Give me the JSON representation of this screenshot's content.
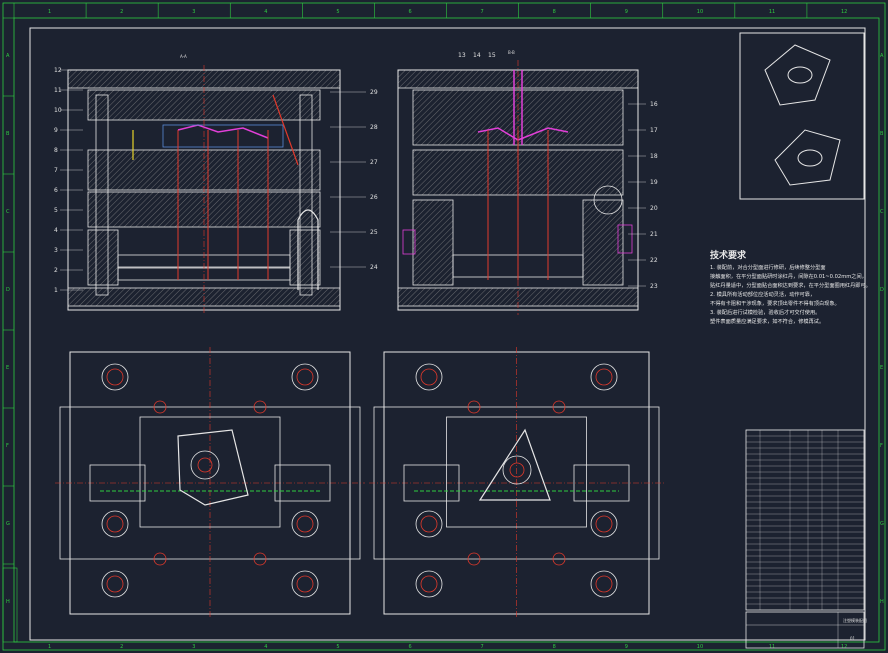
{
  "notes": {
    "title": "技术要求",
    "lines": [
      "1. 装配前，对合分型面进行修研，后续修整分型面",
      "接触面积，在平分型面贴研时涂红丹，间隙在0.01~0.02mm之间，",
      "贴红丹量适中，分型面贴合面积达到要求，在平分型面圈用红丹即可。",
      "2. 模具所有活动部位应活动灵活，动作可靠，",
      "不得有卡阻和干涉现象，要求顶出零件不得有顶白现象。",
      "3. 装配后进行试模检验，验收后才可交付使用。",
      "塑件表面质量应满足要求，如不符合，修模再试。"
    ]
  },
  "drawing": {
    "section_label_left": "A-A",
    "section_label_right": "B-B",
    "left_part_numbers": [
      "12",
      "11",
      "10",
      "9",
      "8",
      "7",
      "6",
      "5",
      "4",
      "3",
      "2",
      "1"
    ],
    "left_right_numbers": [
      "29",
      "28",
      "27",
      "26",
      "25",
      "24"
    ],
    "right_top_numbers": [
      "13",
      "14",
      "15"
    ],
    "right_part_numbers": [
      "16",
      "17",
      "18",
      "19",
      "20",
      "21",
      "22",
      "23"
    ],
    "column_labels": [
      "1",
      "2",
      "3",
      "4",
      "5",
      "6",
      "7",
      "8",
      "9",
      "10",
      "11",
      "12"
    ],
    "row_labels": [
      "A",
      "B",
      "C",
      "D",
      "E",
      "F",
      "G",
      "H"
    ]
  },
  "title_block": {
    "drawing_title": "注塑模装配图",
    "sheet": "01"
  },
  "colors": {
    "background": "#1c2230",
    "line_white": "#e6e6e6",
    "line_red": "#e0392b",
    "line_green": "#2ecc40",
    "line_magenta": "#e23fd8",
    "line_yellow": "#e6d22a",
    "hatch": "#8a8a8a"
  }
}
